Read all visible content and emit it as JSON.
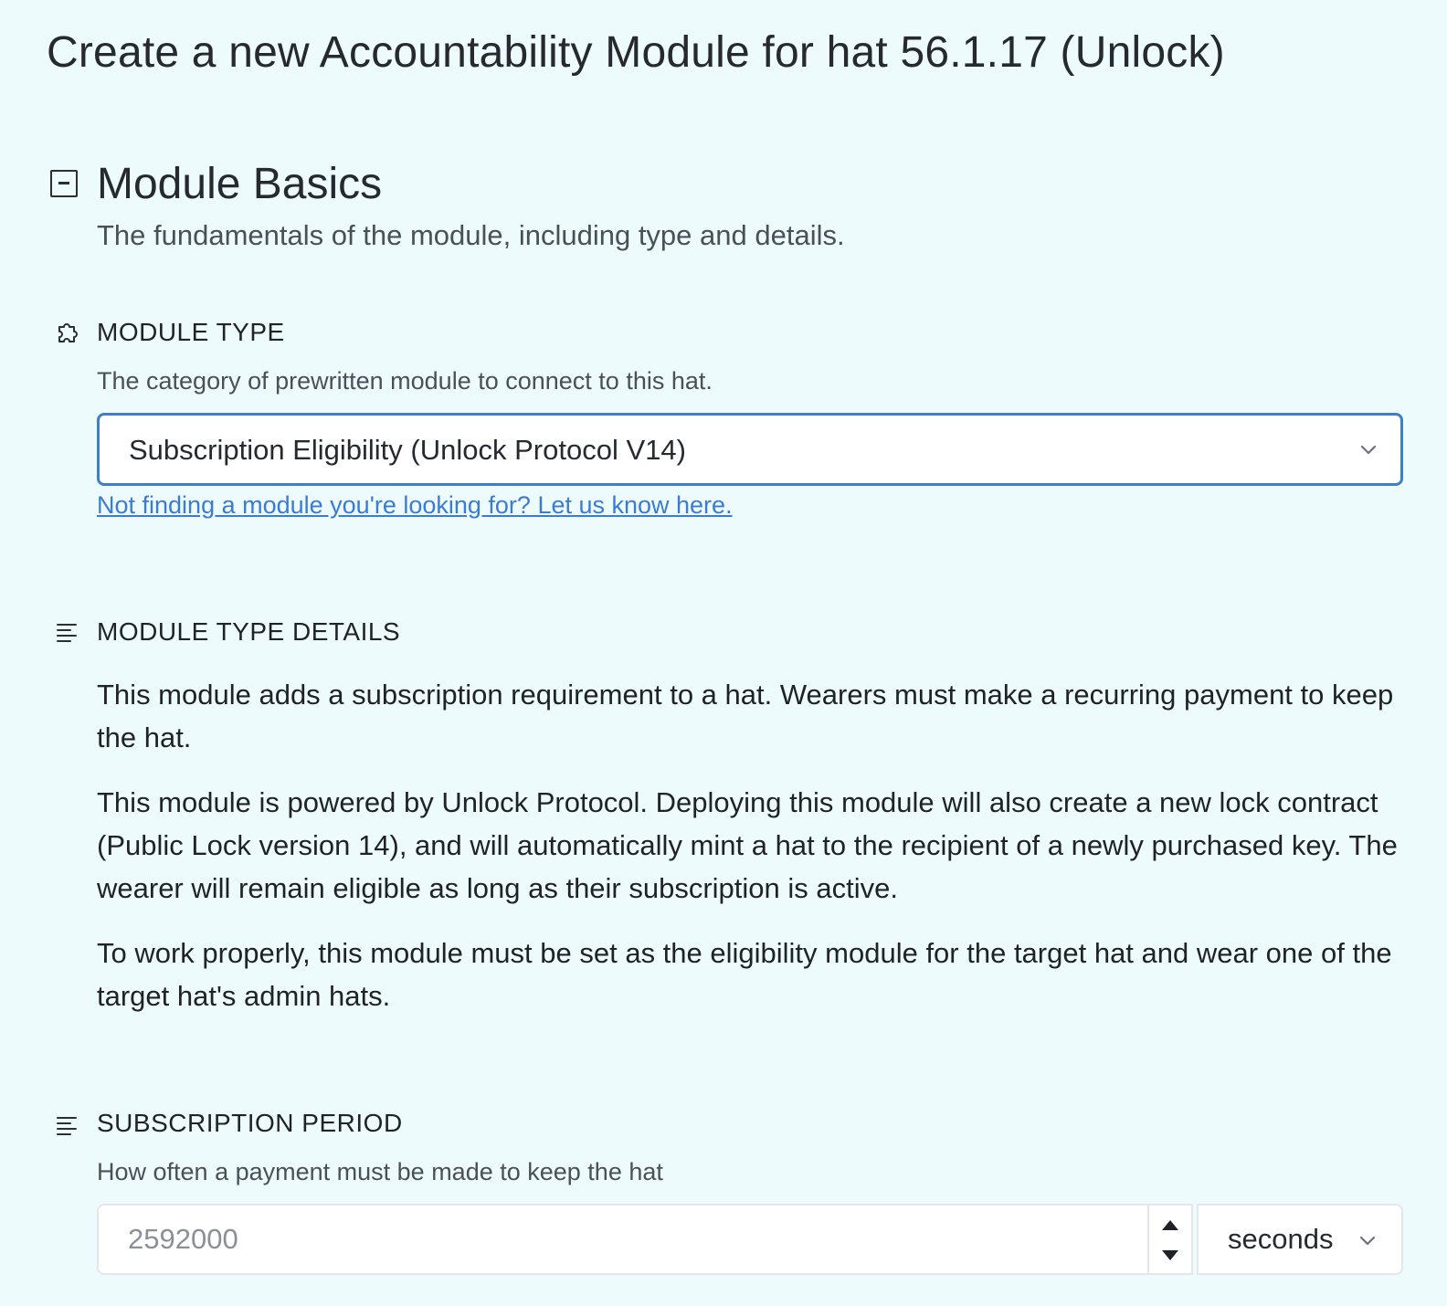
{
  "page": {
    "title": "Create a new Accountability Module for hat 56.1.17 (Unlock)"
  },
  "section": {
    "title": "Module Basics",
    "description": "The fundamentals of the module, including type and details.",
    "toggle_icon": "collapse-square-icon"
  },
  "module_type": {
    "icon": "puzzle-icon",
    "label": "MODULE TYPE",
    "help": "The category of prewritten module to connect to this hat.",
    "selected": "Subscription Eligibility (Unlock Protocol V14)",
    "link": "Not finding a module you're looking for? Let us know here."
  },
  "module_type_details": {
    "icon": "text-lines-icon",
    "label": "MODULE TYPE DETAILS",
    "paragraphs": [
      "This module adds a subscription requirement to a hat. Wearers must make a recurring payment to keep the hat.",
      "This module is powered by Unlock Protocol. Deploying this module will also create a new lock contract (Public Lock version 14), and will automatically mint a hat to the recipient of a newly purchased key. The wearer will remain eligible as long as their subscription is active.",
      "To work properly, this module must be set as the eligibility module for the target hat and wear one of the target hat's admin hats."
    ]
  },
  "subscription_period": {
    "icon": "text-lines-icon",
    "label": "SUBSCRIPTION PERIOD",
    "help": "How often a payment must be made to keep the hat",
    "placeholder": "2592000",
    "unit": "seconds"
  },
  "colors": {
    "background": "#eefbfd",
    "accent": "#3f7fc4",
    "link": "#3a7bd5"
  }
}
